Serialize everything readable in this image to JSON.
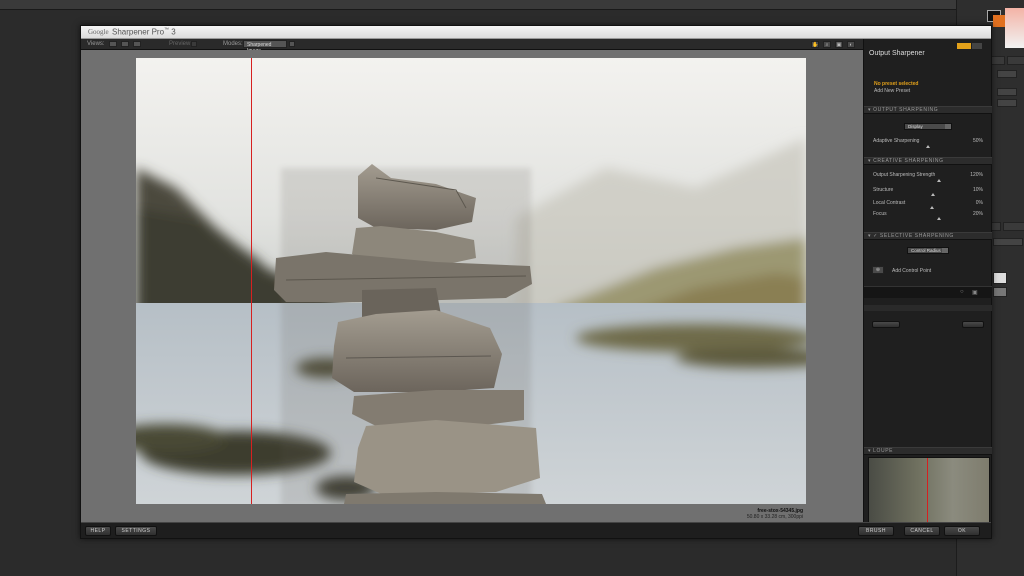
{
  "app": {
    "title_prefix": "Google",
    "title": "Sharpener Pro",
    "title_tm": "™",
    "title_version": "3"
  },
  "toolbar": {
    "views_label": "Views:",
    "preview_label": "Preview",
    "mode_label": "Modes:",
    "mode_value": "Sharpened Image"
  },
  "photo": {
    "filename": "free-stox-54345.jpg",
    "dimensions": "50.80 x 33.28 cm, 300ppi"
  },
  "panel": {
    "title": "Output Sharpener",
    "preset_status": "No preset selected",
    "add_preset": "Add New Preset",
    "sections": {
      "output": "OUTPUT SHARPENING",
      "creative": "CREATIVE SHARPENING",
      "selective": "SELECTIVE SHARPENING",
      "loupe": "LOUPE"
    },
    "output_device": "Display",
    "adaptive_label": "Adaptive Sharpening",
    "adaptive_value": "50%",
    "sliders": [
      {
        "label": "Output Sharpening Strength",
        "value": "120%",
        "frac": 0.55
      },
      {
        "label": "Structure",
        "value": "10%",
        "frac": 0.5
      },
      {
        "label": "Local Contrast",
        "value": "0%",
        "frac": 0.45
      },
      {
        "label": "Focus",
        "value": "20%",
        "frac": 0.5
      }
    ],
    "control_radius": "Control Radius",
    "add_control_point": "Add Control Point"
  },
  "bottom": {
    "help": "HELP",
    "settings": "SETTINGS",
    "brush": "BRUSH",
    "cancel": "CANCEL",
    "ok": "OK"
  },
  "colors": {
    "accent": "#e3a11a",
    "guide_line": "#d62020"
  }
}
